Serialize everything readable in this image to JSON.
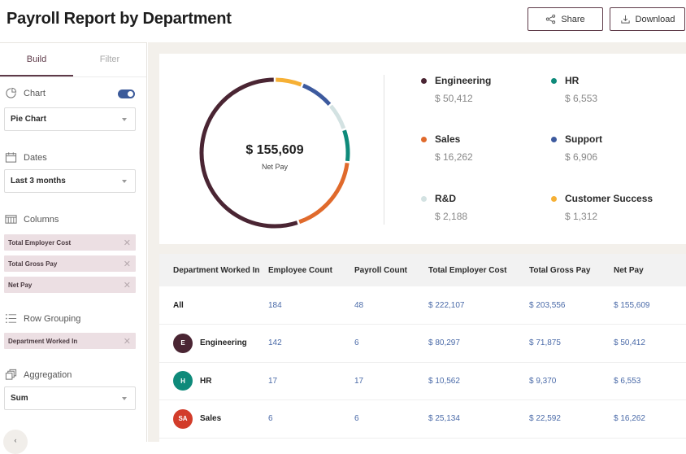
{
  "header": {
    "title": "Payroll Report by Department",
    "share_label": "Share",
    "download_label": "Download"
  },
  "sidebar": {
    "tabs": [
      {
        "label": "Build",
        "active": true
      },
      {
        "label": "Filter",
        "active": false
      }
    ],
    "chart": {
      "label": "Chart",
      "toggle_on": true,
      "select_value": "Pie Chart"
    },
    "dates": {
      "label": "Dates",
      "select_value": "Last 3 months"
    },
    "columns": {
      "label": "Columns",
      "chips": [
        "Total Employer Cost",
        "Total Gross Pay",
        "Net Pay"
      ]
    },
    "row_grouping": {
      "label": "Row Grouping",
      "chips": [
        "Department Worked In"
      ]
    },
    "aggregation": {
      "label": "Aggregation",
      "select_value": "Sum"
    },
    "chip_remove_glyph": "✕",
    "collapse_glyph": "‹"
  },
  "chart_data": {
    "type": "pie",
    "title": "Net Pay",
    "center_value": "$ 155,609",
    "center_label": "Net Pay",
    "slices": [
      {
        "name": "Engineering",
        "value": 50412,
        "display": "$ 50,412",
        "color": "#4a2533"
      },
      {
        "name": "HR",
        "value": 6553,
        "display": "$ 6,553",
        "color": "#0e8a7a"
      },
      {
        "name": "Sales",
        "value": 16262,
        "display": "$ 16,262",
        "color": "#e06a2c"
      },
      {
        "name": "Support",
        "value": 6906,
        "display": "$ 6,906",
        "color": "#3d5a9e"
      },
      {
        "name": "R&D",
        "value": 2188,
        "display": "$ 2,188",
        "color": "#d3e2e2"
      },
      {
        "name": "Customer Success",
        "value": 1312,
        "display": "$ 1,312",
        "color": "#f6b035"
      }
    ],
    "draw_order": [
      "Customer Success",
      "Support",
      "R&D",
      "HR",
      "Sales",
      "Engineering"
    ],
    "legend_placement": "right"
  },
  "table": {
    "headers": [
      "Department Worked In",
      "Employee Count",
      "Payroll Count",
      "Total Employer Cost",
      "Total Gross Pay",
      "Net Pay"
    ],
    "rows": [
      {
        "dept": "All",
        "avatar": null,
        "avatar_color": null,
        "employee_count": "184",
        "payroll_count": "48",
        "employer_cost": "$ 222,107",
        "gross_pay": "$ 203,556",
        "net_pay": "$ 155,609"
      },
      {
        "dept": "Engineering",
        "avatar": "E",
        "avatar_color": "#4a2533",
        "employee_count": "142",
        "payroll_count": "6",
        "employer_cost": "$ 80,297",
        "gross_pay": "$ 71,875",
        "net_pay": "$ 50,412"
      },
      {
        "dept": "HR",
        "avatar": "H",
        "avatar_color": "#0e8a7a",
        "employee_count": "17",
        "payroll_count": "17",
        "employer_cost": "$ 10,562",
        "gross_pay": "$ 9,370",
        "net_pay": "$ 6,553"
      },
      {
        "dept": "Sales",
        "avatar": "SA",
        "avatar_color": "#d23c2a",
        "employee_count": "6",
        "payroll_count": "6",
        "employer_cost": "$ 25,134",
        "gross_pay": "$ 22,592",
        "net_pay": "$ 16,262"
      }
    ]
  }
}
